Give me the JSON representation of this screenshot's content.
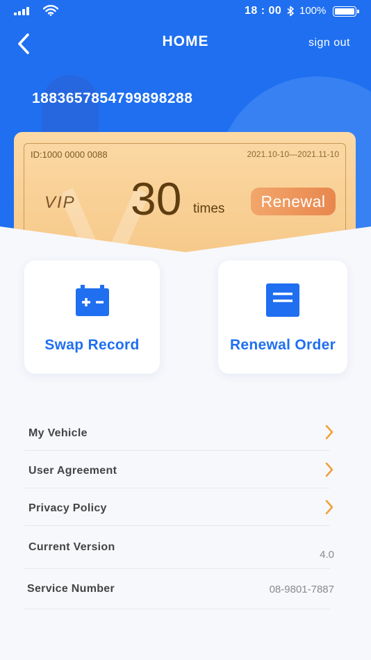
{
  "status_bar": {
    "time": "18 : 00",
    "battery": "100%"
  },
  "nav": {
    "title": "HOME",
    "sign_out": "sign out"
  },
  "user": {
    "phone": "1883657854799898288"
  },
  "membership_card": {
    "id": "ID:1000 0000 0088",
    "validity": "2021.10-10—2021.11-10",
    "tier": "VIP",
    "count": "30",
    "unit": "times",
    "renewal_label": "Renewal"
  },
  "tiles": [
    {
      "label": "Swap Record",
      "icon": "battery-icon"
    },
    {
      "label": "Renewal Order",
      "icon": "document-icon"
    }
  ],
  "menu": {
    "my_vehicle": "My Vehicle",
    "user_agreement": "User Agreement",
    "privacy_policy": "Privacy Policy",
    "current_version": "Current Version",
    "version_value": "4.0",
    "service_number": "Service Number",
    "service_value": "08-9801-7887"
  },
  "colors": {
    "primary": "#1f6ff0",
    "card_gold": "#f6c888",
    "renewal_orange": "#e8874e",
    "chevron": "#f0a03c"
  }
}
